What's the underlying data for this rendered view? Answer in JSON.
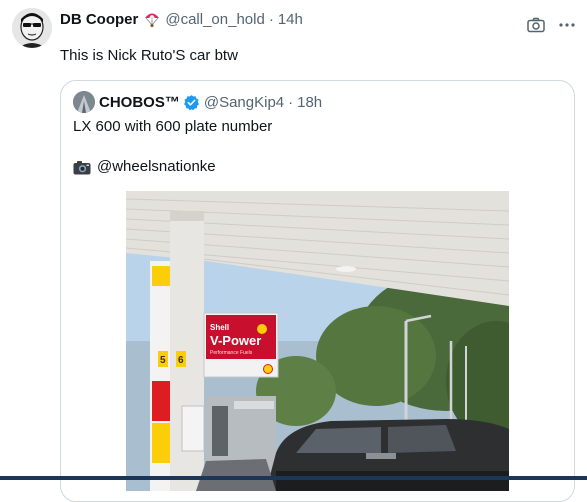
{
  "tweet": {
    "author_name": "DB Cooper",
    "author_emoji": "parachute",
    "handle": "@call_on_hold",
    "separator": "·",
    "time": "14h",
    "text": "This is Nick Ruto'S car btw"
  },
  "quote": {
    "author_name": "CHOBOS™",
    "verified": true,
    "handle": "@SangKip4",
    "separator": "·",
    "time": "18h",
    "line1": "LX 600 with 600 plate number",
    "line2": "@wheelsnationke"
  },
  "photo": {
    "sign_brand": "Shell",
    "sign_product": "V-Power",
    "sign_sub": "Performance Fuels",
    "pump_numbers": [
      "5",
      "6"
    ]
  },
  "icons": {
    "more": "more-icon",
    "camera": "camera-icon",
    "verified": "verified-badge-icon"
  },
  "colors": {
    "text": "#0f1419",
    "secondary": "#536471",
    "border": "#cfd9de",
    "verified": "#1d9bf0",
    "shell_red": "#dd1d21",
    "shell_yellow": "#fbce07"
  }
}
